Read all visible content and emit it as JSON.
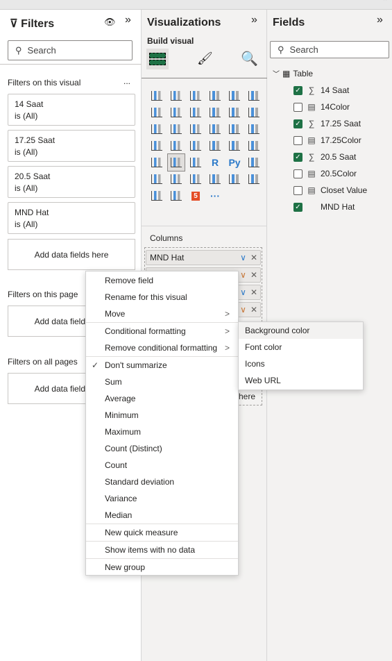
{
  "filters": {
    "title": "Filters",
    "search_placeholder": "Search",
    "on_visual": "Filters on this visual",
    "more": "...",
    "cards": [
      {
        "name": "14 Saat",
        "value": "is (All)"
      },
      {
        "name": "17.25 Saat",
        "value": "is (All)"
      },
      {
        "name": "20.5 Saat",
        "value": "is (All)"
      },
      {
        "name": "MND Hat",
        "value": "is (All)"
      }
    ],
    "add_label": "Add data fields here",
    "on_page": "Filters on this page",
    "on_all": "Filters on all pages"
  },
  "viz": {
    "title": "Visualizations",
    "build": "Build visual",
    "columns": "Columns",
    "icons": [
      "stacked-bar",
      "stacked-column",
      "clustered-bar",
      "clustered-column",
      "100-bar",
      "100-column",
      "line",
      "area",
      "stacked-area",
      "line-column",
      "line-clustered",
      "ribbon",
      "waterfall",
      "funnel",
      "scatter",
      "pie",
      "donut",
      "treemap",
      "map",
      "filled-map",
      "gauge",
      "card",
      "multirow-card",
      "kpi",
      "slicer",
      "table",
      "matrix",
      "R",
      "Py",
      "key-influencers",
      "decomposition-tree",
      "qa",
      "paginated",
      "trophy",
      "report",
      "azure-map",
      "power-apps",
      "power-automate",
      "html5",
      "more"
    ],
    "wells": [
      "MND Hat",
      "",
      "",
      ""
    ],
    "add_tail": "here"
  },
  "fields": {
    "title": "Fields",
    "search_placeholder": "Search",
    "table": "Table",
    "items": [
      {
        "name": "14 Saat",
        "checked": true,
        "icon": "sigma"
      },
      {
        "name": "14Color",
        "checked": false,
        "icon": "calc"
      },
      {
        "name": "17.25 Saat",
        "checked": true,
        "icon": "sigma"
      },
      {
        "name": "17.25Color",
        "checked": false,
        "icon": "calc"
      },
      {
        "name": "20.5 Saat",
        "checked": true,
        "icon": "sigma"
      },
      {
        "name": "20.5Color",
        "checked": false,
        "icon": "calc"
      },
      {
        "name": "Closet Value",
        "checked": false,
        "icon": "calc"
      },
      {
        "name": "MND Hat",
        "checked": true,
        "icon": ""
      }
    ]
  },
  "menu": {
    "group1": [
      "Remove field",
      "Rename for this visual",
      "Move"
    ],
    "group2": [
      "Conditional formatting",
      "Remove conditional formatting"
    ],
    "group3": [
      "Don't summarize",
      "Sum",
      "Average",
      "Minimum",
      "Maximum",
      "Count (Distinct)",
      "Count",
      "Standard deviation",
      "Variance",
      "Median"
    ],
    "quick": "New quick measure",
    "nodata": "Show items with no data",
    "group": "New group"
  },
  "submenu": [
    "Background color",
    "Font color",
    "Icons",
    "Web URL"
  ],
  "colors": {
    "accent": "#1e7145",
    "check": "#1e7145"
  }
}
